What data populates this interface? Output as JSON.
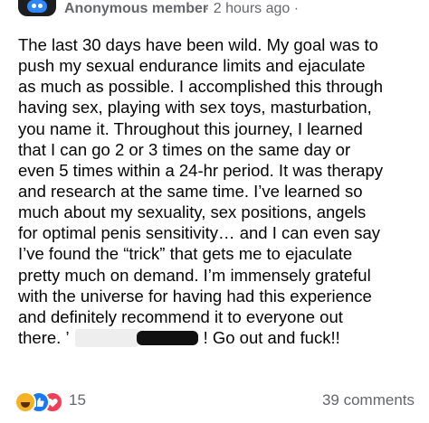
{
  "post": {
    "author": "Anonymous member",
    "time": "· 2 hours ago ·",
    "lines": [
      "The last 30 days have been wild. My goal was to",
      "push my sexual endurance limits and ejaculate",
      "as much as possible. I accomplished this through",
      "having sex, playing with sex toys, masturbation,",
      "you name it. Throughout this journey, I learned",
      "that I can go 2 or 3 times on the same day or",
      "even 5 times within a 24-hr period. It was therapy",
      "and research at the same time. I’ve learned so",
      "much about my sexuality, sex positions, angels",
      "for optimal penis sensitivity… and I can even say",
      "I’ve found the “trick” that gets me to ejaculate",
      "pretty much on demand. I’m immensely grateful",
      "with the universe for having had this experience",
      "and definitely recommend it to everyone out"
    ],
    "last_line_start": "there. ’",
    "last_line_end": "! Go out and fuck!!"
  },
  "footer": {
    "reaction_icons": [
      "haha-icon",
      "like-icon",
      "love-icon"
    ],
    "reaction_count": "15",
    "comments": "39 comments"
  },
  "colors": {
    "meta_gray": "#65676b",
    "like_blue": "#1877f2",
    "love_red": "#f33e58",
    "haha_yellow": "#f7b125"
  }
}
